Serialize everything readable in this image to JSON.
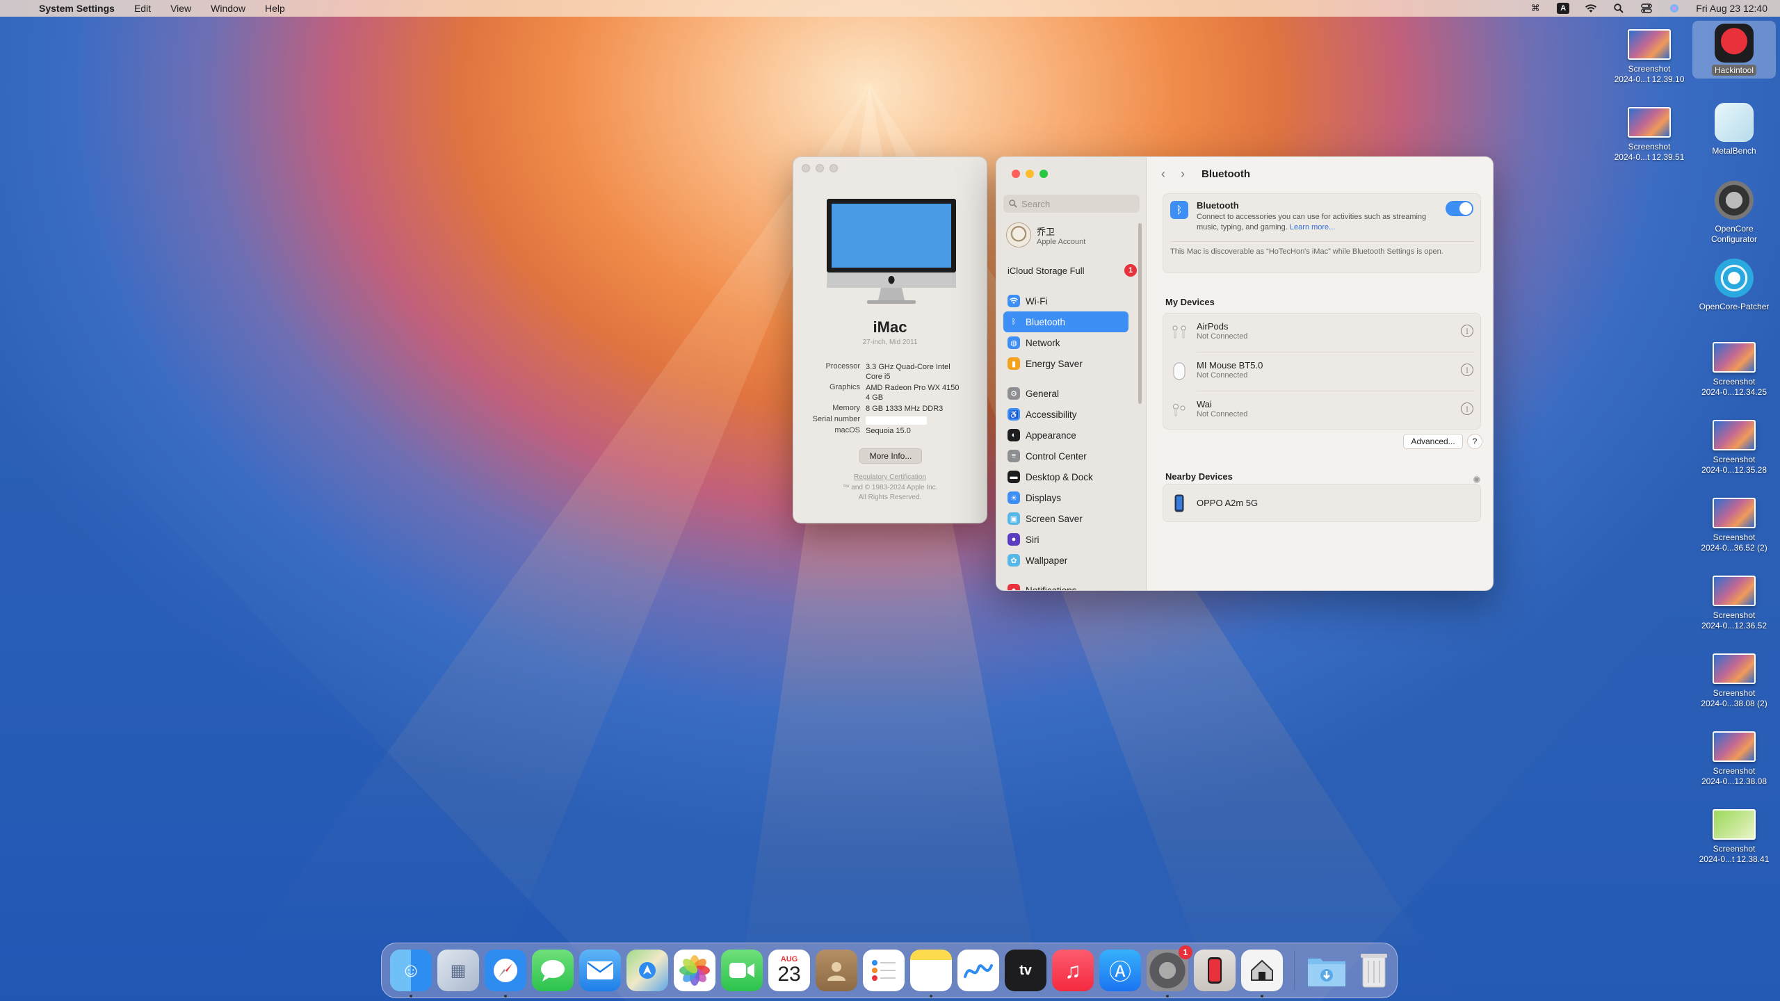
{
  "menubar": {
    "app_name": "System Settings",
    "items": [
      "Edit",
      "View",
      "Window",
      "Help"
    ],
    "datetime": "Fri Aug 23  12:40",
    "input_letter": "A"
  },
  "about": {
    "model": "iMac",
    "model_sub": "27-inch, Mid 2011",
    "specs": [
      {
        "k": "Processor",
        "v": "3.3 GHz Quad-Core Intel Core i5"
      },
      {
        "k": "Graphics",
        "v": "AMD Radeon Pro WX 4150 4 GB"
      },
      {
        "k": "Memory",
        "v": "8 GB 1333 MHz DDR3"
      },
      {
        "k": "Serial number",
        "v": ""
      },
      {
        "k": "macOS",
        "v": "Sequoia 15.0"
      }
    ],
    "more_info": "More Info...",
    "regulatory": "Regulatory Certification",
    "copyright_1": "™ and © 1983-2024 Apple Inc.",
    "copyright_2": "All Rights Reserved."
  },
  "settings": {
    "search_placeholder": "Search",
    "account_name": "乔卫",
    "account_sub": "Apple Account",
    "icloud_label": "iCloud Storage Full",
    "icloud_badge": "1",
    "sidebar": [
      {
        "label": "Wi-Fi",
        "icon": "wifi-icon",
        "color": "#3d8ff6"
      },
      {
        "label": "Bluetooth",
        "icon": "bluetooth-icon",
        "color": "#3d8ff6",
        "active": true
      },
      {
        "label": "Network",
        "icon": "globe-icon",
        "color": "#3d8ff6"
      },
      {
        "label": "Energy Saver",
        "icon": "battery-icon",
        "color": "#f4a11e"
      },
      {
        "label": "General",
        "icon": "gear-icon",
        "color": "#8e8e93"
      },
      {
        "label": "Accessibility",
        "icon": "accessibility-icon",
        "color": "#3d8ff6"
      },
      {
        "label": "Appearance",
        "icon": "appearance-icon",
        "color": "#1d1d1f"
      },
      {
        "label": "Control Center",
        "icon": "control-center-icon",
        "color": "#8e8e93"
      },
      {
        "label": "Desktop & Dock",
        "icon": "dock-icon",
        "color": "#1d1d1f"
      },
      {
        "label": "Displays",
        "icon": "displays-icon",
        "color": "#3d8ff6"
      },
      {
        "label": "Screen Saver",
        "icon": "screensaver-icon",
        "color": "#55b8e8"
      },
      {
        "label": "Siri",
        "icon": "siri-icon",
        "color": "#5a3bc1"
      },
      {
        "label": "Wallpaper",
        "icon": "wallpaper-icon",
        "color": "#55b8e8"
      },
      {
        "label": "Notifications",
        "icon": "notifications-icon",
        "color": "#e8313a"
      }
    ],
    "page_title": "Bluetooth",
    "bt_title": "Bluetooth",
    "bt_desc": "Connect to accessories you can use for activities such as streaming music, typing, and gaming.",
    "bt_learn_more": "Learn more...",
    "bt_enabled": true,
    "bt_discoverable": "This Mac is discoverable as “HoTecHon's iMac” while Bluetooth Settings is open.",
    "my_devices_title": "My Devices",
    "my_devices": [
      {
        "name": "AirPods",
        "status": "Not Connected",
        "icon": "airpods-icon"
      },
      {
        "name": "MI Mouse BT5.0",
        "status": "Not Connected",
        "icon": "mouse-icon"
      },
      {
        "name": "Wai",
        "status": "Not Connected",
        "icon": "airpods-icon"
      }
    ],
    "advanced_label": "Advanced...",
    "help_label": "?",
    "nearby_title": "Nearby Devices",
    "nearby_devices": [
      {
        "name": "OPPO A2m 5G",
        "icon": "phone-icon"
      }
    ]
  },
  "desktop_icons": [
    {
      "label_1": "Screenshot",
      "label_2": "2024-0...t 12.39.10"
    },
    {
      "label_1": "Hackintool",
      "label_2": ""
    },
    {
      "label_1": "Screenshot",
      "label_2": "2024-0...t 12.39.51"
    },
    {
      "label_1": "MetalBench",
      "label_2": ""
    },
    {
      "label_1": "OpenCore",
      "label_2": "Configurator"
    },
    {
      "label_1": "OpenCore-Patcher",
      "label_2": ""
    },
    {
      "label_1": "Screenshot",
      "label_2": "2024-0...12.34.25"
    },
    {
      "label_1": "Screenshot",
      "label_2": "2024-0...12.35.28"
    },
    {
      "label_1": "Screenshot",
      "label_2": "2024-0...36.52 (2)"
    },
    {
      "label_1": "Screenshot",
      "label_2": "2024-0...12.36.52"
    },
    {
      "label_1": "Screenshot",
      "label_2": "2024-0...38.08 (2)"
    },
    {
      "label_1": "Screenshot",
      "label_2": "2024-0...12.38.08"
    },
    {
      "label_1": "Screenshot",
      "label_2": "2024-0...t 12.38.41"
    }
  ],
  "dock": {
    "calendar_month": "AUG",
    "calendar_day": "23",
    "settings_badge": "1",
    "apps": [
      "Finder",
      "Launchpad",
      "Safari",
      "Messages",
      "Mail",
      "Maps",
      "Photos",
      "FaceTime",
      "Calendar",
      "Contacts",
      "Reminders",
      "Notes",
      "Freeform",
      "TV",
      "Music",
      "App Store",
      "System Settings",
      "iPhone Mirroring",
      "Hackintool",
      "Downloads",
      "Trash"
    ]
  }
}
